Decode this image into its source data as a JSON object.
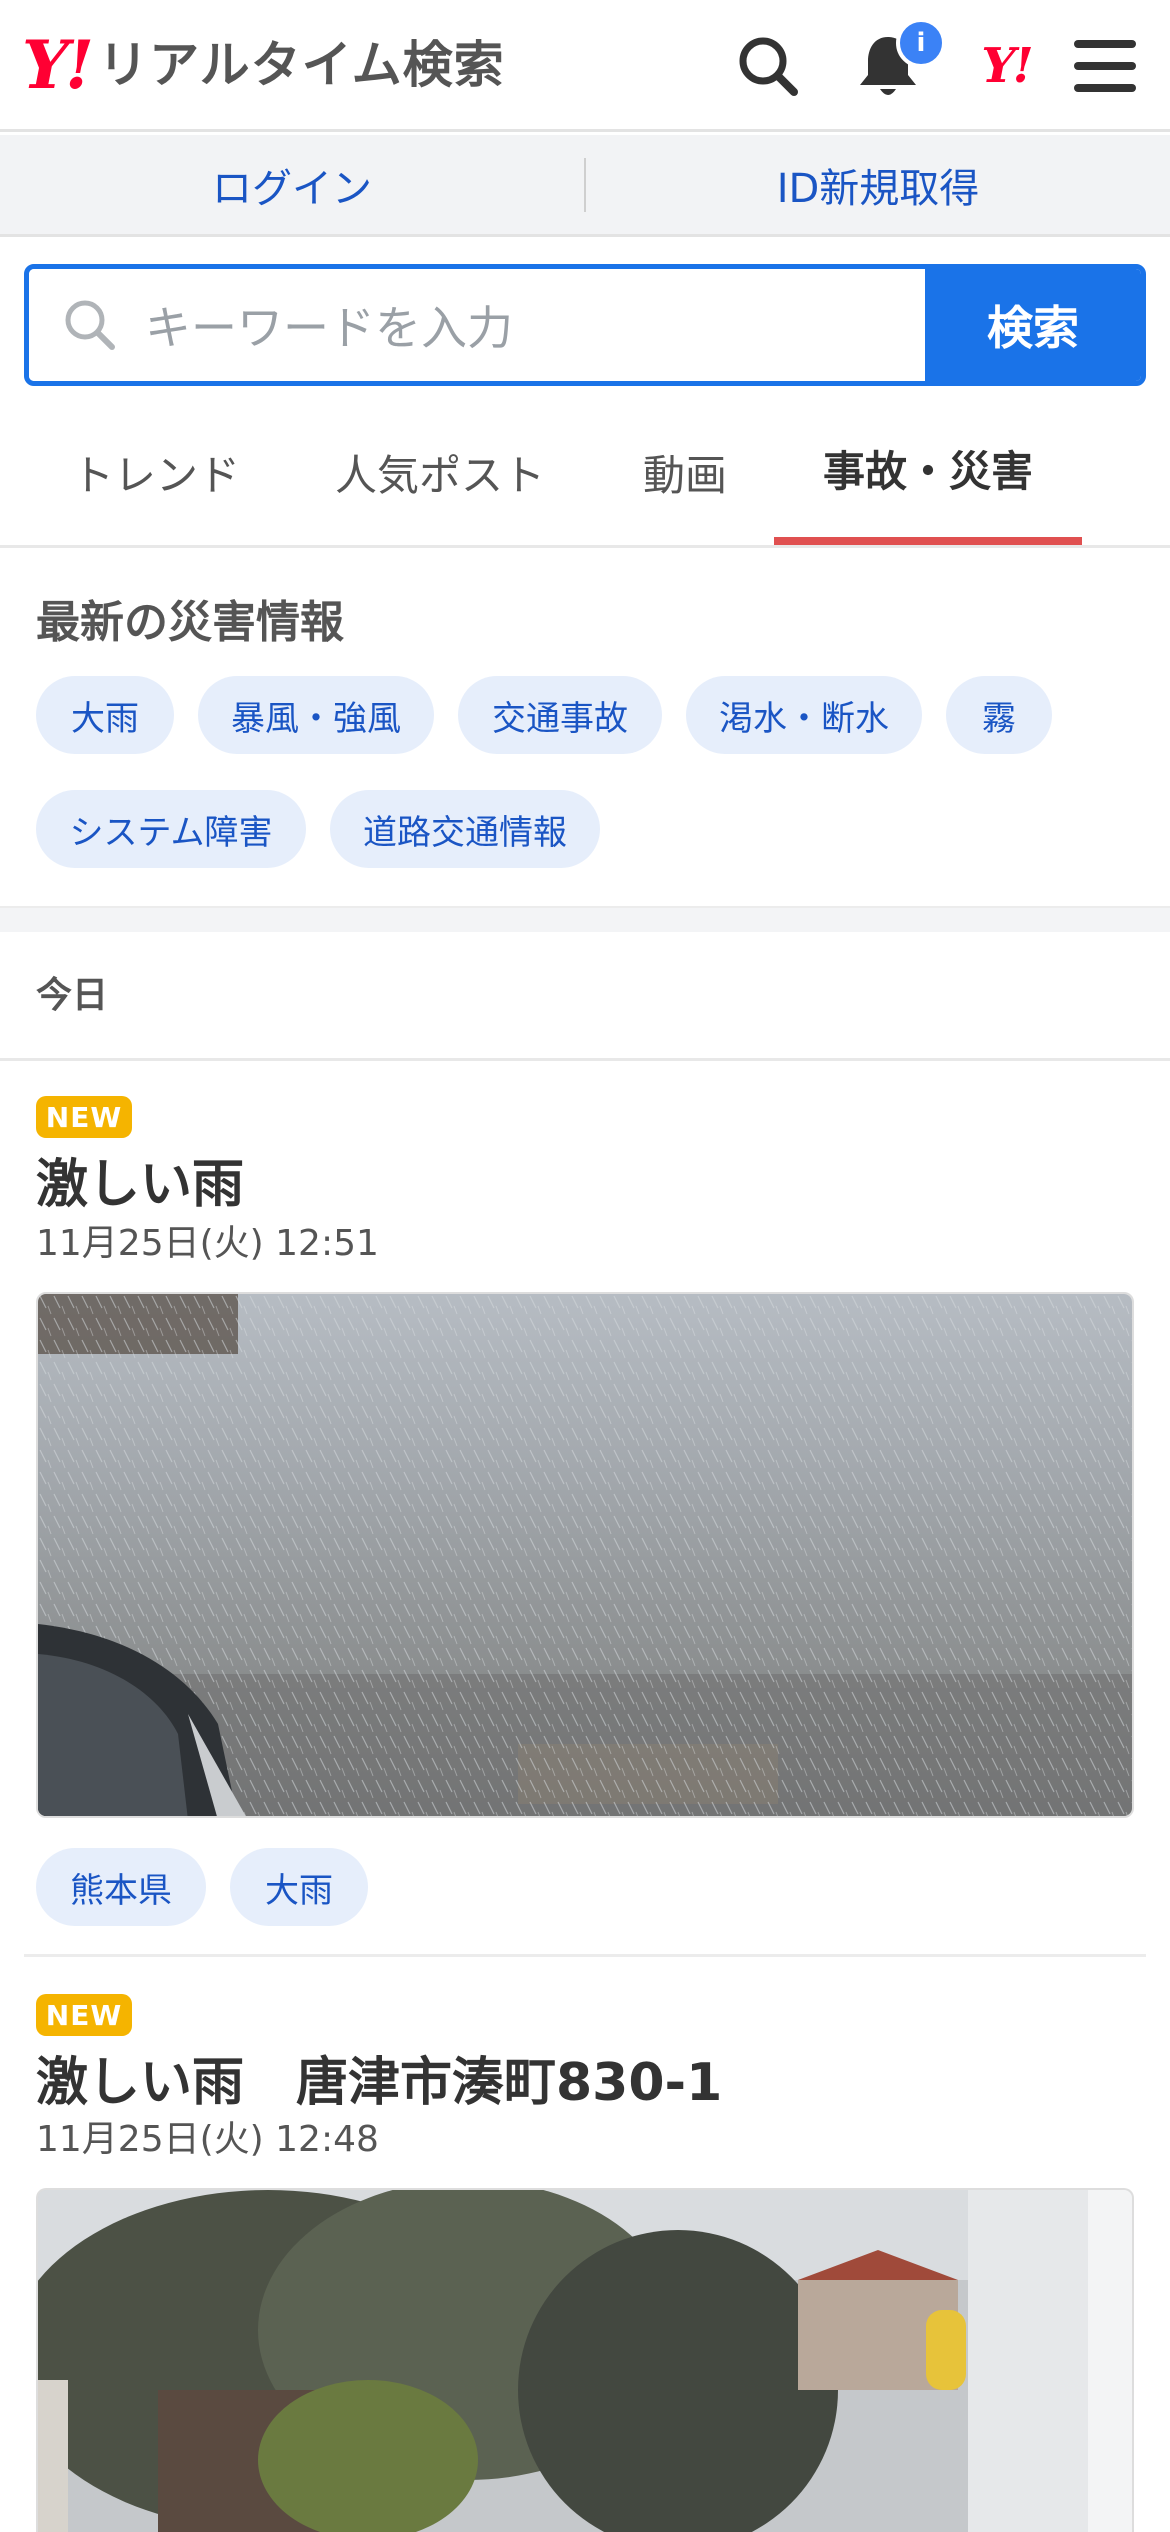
{
  "header": {
    "logo_mark": "Y!",
    "logo_text": "リアルタイム検索",
    "notification_badge": "i",
    "yj_mark": "Y!"
  },
  "loginbar": {
    "login": "ログイン",
    "register": "ID新規取得"
  },
  "search": {
    "placeholder": "キーワードを入力",
    "button": "検索"
  },
  "tabs": [
    {
      "label": "トレンド",
      "active": false
    },
    {
      "label": "人気ポスト",
      "active": false
    },
    {
      "label": "動画",
      "active": false
    },
    {
      "label": "事故・災害",
      "active": true
    }
  ],
  "disaster": {
    "title": "最新の災害情報",
    "chips": [
      "大雨",
      "暴風・強風",
      "交通事故",
      "渇水・断水",
      "霧",
      "システム障害",
      "道路交通情報"
    ]
  },
  "section_label": "今日",
  "posts": [
    {
      "badge": "NEW",
      "title": "激しい雨",
      "date": "11月25日(火) 12:51",
      "tags": [
        "熊本県",
        "大雨"
      ]
    },
    {
      "badge": "NEW",
      "title": "激しい雨　唐津市湊町830-1",
      "date": "11月25日(火) 12:48"
    }
  ],
  "colors": {
    "brand_red": "#ff0033",
    "accent_blue": "#1a73e8",
    "link_blue": "#1a55c4",
    "tab_active_underline": "#e05050",
    "new_badge": "#f5b400",
    "chip_bg": "#e6eefb"
  }
}
